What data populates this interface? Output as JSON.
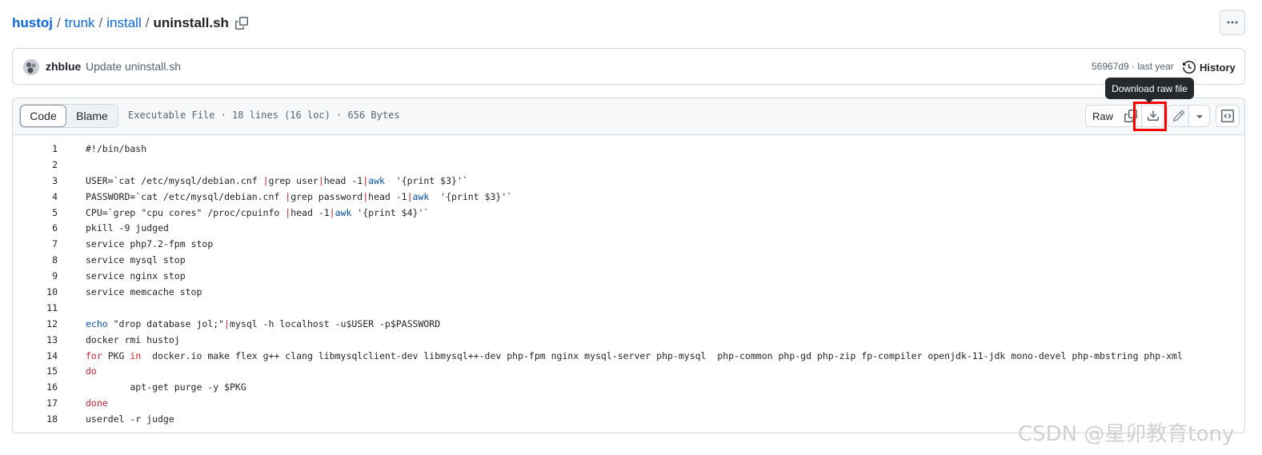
{
  "breadcrumb": {
    "repo": "hustoj",
    "path1": "trunk",
    "path2": "install",
    "file": "uninstall.sh",
    "sep": "/"
  },
  "commit": {
    "author": "zhblue",
    "message": "Update uninstall.sh",
    "sha_time": "56967d9 · last year",
    "history_label": "History"
  },
  "tooltip": "Download raw file",
  "file_header": {
    "tabs": [
      {
        "label": "Code",
        "active": true
      },
      {
        "label": "Blame",
        "active": false
      }
    ],
    "info": "Executable File · 18 lines (16 loc) · 656 Bytes",
    "raw_label": "Raw"
  },
  "code": {
    "lines": [
      {
        "n": "1",
        "t": "#!/bin/bash"
      },
      {
        "n": "2",
        "t": ""
      },
      {
        "n": "3",
        "t": "USER=`cat /etc/mysql/debian.cnf |grep user|head -1|awk  '{print $3}'`"
      },
      {
        "n": "4",
        "t": "PASSWORD=`cat /etc/mysql/debian.cnf |grep password|head -1|awk  '{print $3}'`"
      },
      {
        "n": "5",
        "t": "CPU=`grep \"cpu cores\" /proc/cpuinfo |head -1|awk '{print $4}'`"
      },
      {
        "n": "6",
        "t": "pkill -9 judged"
      },
      {
        "n": "7",
        "t": "service php7.2-fpm stop"
      },
      {
        "n": "8",
        "t": "service mysql stop"
      },
      {
        "n": "9",
        "t": "service nginx stop"
      },
      {
        "n": "10",
        "t": "service memcache stop"
      },
      {
        "n": "11",
        "t": ""
      },
      {
        "n": "12",
        "t": "echo \"drop database jol;\"|mysql -h localhost -u$USER -p$PASSWORD"
      },
      {
        "n": "13",
        "t": "docker rmi hustoj"
      },
      {
        "n": "14",
        "t": "for PKG in  docker.io make flex g++ clang libmysqlclient-dev libmysql++-dev php-fpm nginx mysql-server php-mysql  php-common php-gd php-zip fp-compiler openjdk-11-jdk mono-devel php-mbstring php-xml"
      },
      {
        "n": "15",
        "t": "do"
      },
      {
        "n": "16",
        "t": "        apt-get purge -y $PKG"
      },
      {
        "n": "17",
        "t": "done"
      },
      {
        "n": "18",
        "t": "userdel -r judge"
      }
    ]
  },
  "watermark": "CSDN @星卯教育tony",
  "colors": {
    "link": "#0969da",
    "keyword": "#cf222e",
    "builtin": "#0550ae",
    "highlight": "#ff0000"
  }
}
